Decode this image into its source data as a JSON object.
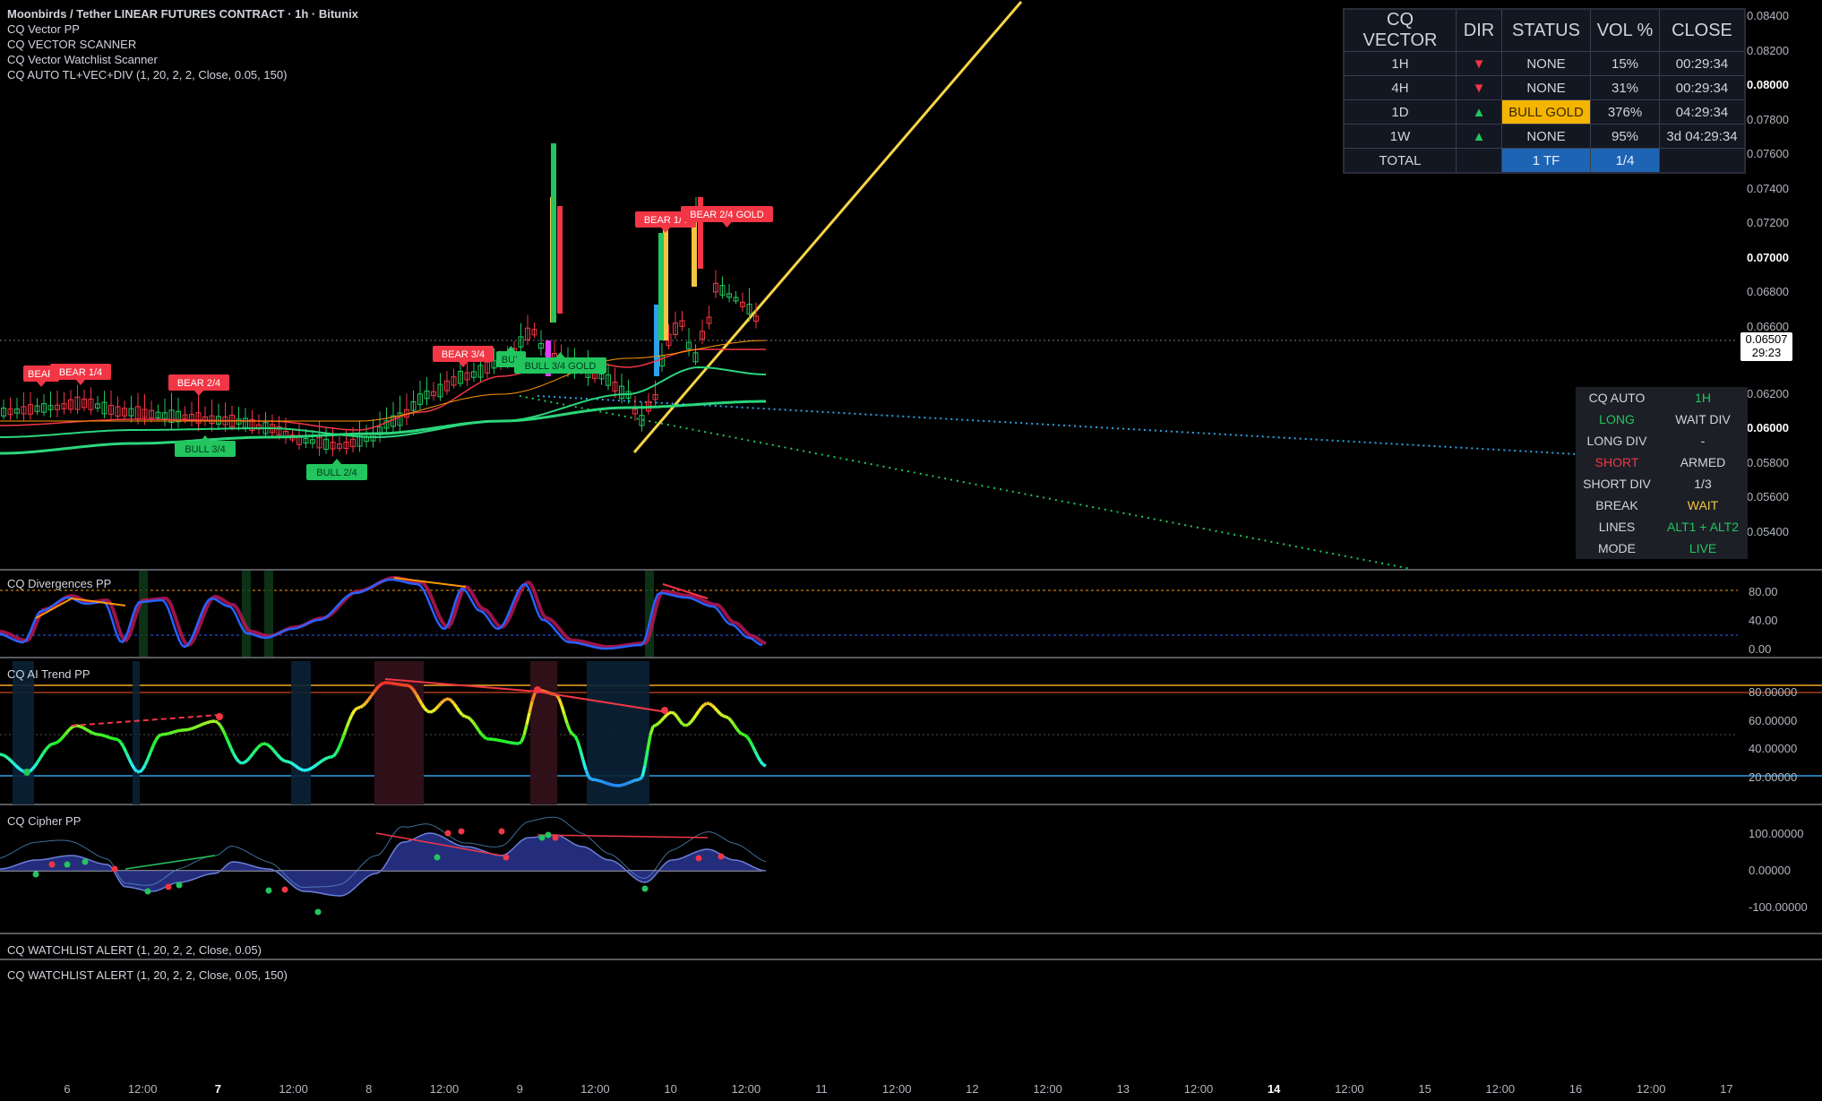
{
  "legend": {
    "title": "Moonbirds / Tether LINEAR FUTURES CONTRACT · 1h · Bitunix",
    "lines": [
      "CQ Vector PP",
      "CQ VECTOR SCANNER",
      "CQ Vector Watchlist Scanner",
      "CQ AUTO TL+VEC+DIV (1, 20, 2, 2, Close, 0.05, 150)"
    ]
  },
  "price_axis": {
    "labels": [
      "0.08400",
      "0.08200",
      "0.08000",
      "0.07800",
      "0.07600",
      "0.07400",
      "0.07200",
      "0.07000",
      "0.06800",
      "0.06600",
      "0.06200",
      "0.06000",
      "0.05800",
      "0.05600",
      "0.05400"
    ],
    "bold": [
      "0.08000",
      "0.07000",
      "0.06000"
    ],
    "current_price": "0.06507",
    "countdown": "29:23"
  },
  "time_axis": {
    "labels": [
      "6",
      "12:00",
      "7",
      "12:00",
      "8",
      "12:00",
      "9",
      "12:00",
      "10",
      "12:00",
      "11",
      "12:00",
      "12",
      "12:00",
      "13",
      "12:00",
      "14",
      "12:00",
      "15",
      "12:00",
      "16",
      "12:00",
      "17"
    ],
    "bold": [
      "7",
      "14"
    ]
  },
  "signals": {
    "bear": [
      "BEAR",
      "BEAR 1/4",
      "BEAR 2/4",
      "BEAR 3/4",
      "BEAR 1/4",
      "BEAR 2/4 GOLD"
    ],
    "bull": [
      "BULL 3/4",
      "BULL 2/4",
      "BUL",
      "BULL 3/4 GOLD"
    ]
  },
  "vector_table": {
    "headers": [
      "CQ VECTOR",
      "DIR",
      "STATUS",
      "VOL %",
      "CLOSE"
    ],
    "rows": [
      {
        "tf": "1H",
        "dir": "▼",
        "status": "NONE",
        "vol": "15%",
        "close": "00:29:34"
      },
      {
        "tf": "4H",
        "dir": "▼",
        "status": "NONE",
        "vol": "31%",
        "close": "00:29:34"
      },
      {
        "tf": "1D",
        "dir": "▲",
        "status": "BULL GOLD",
        "vol": "376%",
        "close": "04:29:34"
      },
      {
        "tf": "1W",
        "dir": "▲",
        "status": "NONE",
        "vol": "95%",
        "close": "3d 04:29:34"
      }
    ],
    "total": {
      "label": "TOTAL",
      "dir": "",
      "status": "1 TF",
      "vol": "1/4",
      "close": ""
    }
  },
  "auto_table": {
    "rows": [
      {
        "k": "CQ AUTO",
        "v": "1H"
      },
      {
        "k": "LONG",
        "v": "WAIT DIV"
      },
      {
        "k": "LONG DIV",
        "v": "-"
      },
      {
        "k": "SHORT",
        "v": "ARMED"
      },
      {
        "k": "SHORT DIV",
        "v": "1/3"
      },
      {
        "k": "BREAK",
        "v": "WAIT"
      },
      {
        "k": "LINES",
        "v": "ALT1 + ALT2"
      },
      {
        "k": "MODE",
        "v": "LIVE"
      }
    ]
  },
  "panes": {
    "divergences": {
      "title": "CQ Divergences PP",
      "labels": [
        "80.00",
        "40.00",
        "0.00"
      ]
    },
    "ai_trend": {
      "title": "CQ AI Trend PP",
      "labels": [
        "80.00000",
        "60.00000",
        "40.00000",
        "20.00000"
      ]
    },
    "cipher": {
      "title": "CQ Cipher PP",
      "labels": [
        "100.00000",
        "0.00000",
        "-100.00000"
      ]
    },
    "alert1": {
      "title": "CQ WATCHLIST ALERT (1, 20, 2, 2, Close, 0.05)"
    },
    "alert2": {
      "title": "CQ WATCHLIST ALERT (1, 20, 2, 2, Close, 0.05, 150)"
    }
  },
  "colors": {
    "bull": "#22c55e",
    "bear": "#f23645",
    "gold": "#f5c542",
    "trendline": "#f5d547",
    "bg": "#000000"
  }
}
